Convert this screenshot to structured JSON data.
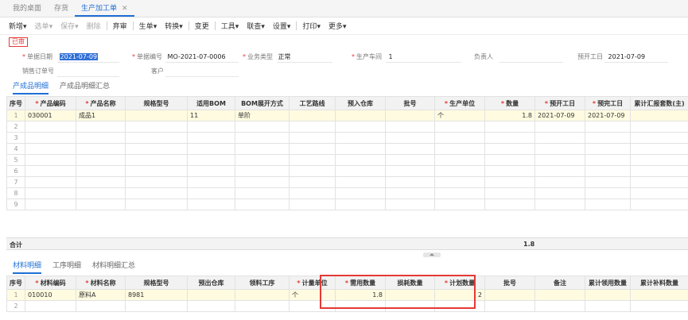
{
  "tabs": [
    {
      "label": "我的桌面"
    },
    {
      "label": "存货"
    },
    {
      "label": "生产加工单",
      "close": "✕"
    }
  ],
  "toolbar": {
    "new": "新增",
    "select": "选单",
    "save": "保存",
    "delete": "删除",
    "abandon": "弃审",
    "generate": "生单",
    "convert": "转换",
    "change": "变更",
    "tools": "工具",
    "query": "联查",
    "settings": "设置",
    "print": "打印",
    "more": "更多",
    "caret": "▾"
  },
  "status": "已审",
  "form": {
    "date_label": "单据日期",
    "date_value": "2021-07-09",
    "number_label": "单据编号",
    "number_value": "MO-2021-07-0006",
    "biztype_label": "业务类型",
    "biztype_value": "正常",
    "workshop_label": "生产车间",
    "workshop_value": "1",
    "owner_label": "负责人",
    "owner_value": "",
    "plan_start_label": "预开工日",
    "plan_start_value": "2021-07-09",
    "sales_order_label": "销售订单号",
    "sales_order_value": "",
    "customer_label": "客户",
    "customer_value": ""
  },
  "product_tabs": [
    {
      "label": "产成品明细"
    },
    {
      "label": "产成品明细汇总"
    }
  ],
  "product_table": {
    "headers": [
      "序号",
      "产品编码",
      "产品名称",
      "规格型号",
      "适用BOM",
      "BOM展开方式",
      "工艺路线",
      "预入仓库",
      "批号",
      "生产单位",
      "数量",
      "预开工日",
      "预完工日",
      "累计汇报套数(主)"
    ],
    "required": [
      false,
      true,
      true,
      false,
      false,
      false,
      false,
      false,
      false,
      true,
      true,
      true,
      true,
      false
    ],
    "rows": [
      [
        "1",
        "030001",
        "成品1",
        "",
        "11",
        "单阶",
        "",
        "",
        "",
        "个",
        "1.8",
        "2021-07-09",
        "2021-07-09",
        ""
      ]
    ],
    "empty_rows": [
      "2",
      "3",
      "4",
      "5",
      "6",
      "7",
      "8",
      "9"
    ]
  },
  "summary": {
    "label": "合计",
    "qty": "1.8"
  },
  "material_tabs": [
    {
      "label": "材料明细"
    },
    {
      "label": "工序明细"
    },
    {
      "label": "材料明细汇总"
    }
  ],
  "material_table": {
    "headers": [
      "序号",
      "材料编码",
      "材料名称",
      "规格型号",
      "预出仓库",
      "领料工序",
      "计量单位",
      "需用数量",
      "损耗数量",
      "计划数量",
      "批号",
      "备注",
      "累计领用数量",
      "累计补料数量"
    ],
    "required": [
      false,
      true,
      true,
      false,
      false,
      false,
      true,
      true,
      false,
      true,
      false,
      false,
      false,
      false
    ],
    "rows": [
      [
        "1",
        "010010",
        "原料A",
        "8981",
        "",
        "",
        "个",
        "1.8",
        "",
        "2",
        "",
        "",
        "",
        ""
      ]
    ],
    "empty_rows": [
      "2"
    ]
  },
  "colors": {
    "accent": "#1f6fd6",
    "highlight": "#e53935",
    "row_highlight": "#fffbe0"
  }
}
